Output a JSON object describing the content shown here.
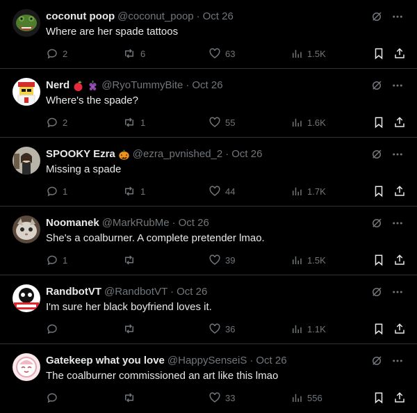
{
  "colors": {
    "background": "#000000",
    "text": "#e7e9ea",
    "muted": "#71767b",
    "divider": "#2f3336"
  },
  "icons": {
    "reply": "reply-icon",
    "retweet": "retweet-icon",
    "like": "heart-icon",
    "views": "views-icon",
    "bookmark": "bookmark-icon",
    "share": "share-icon",
    "grok": "grok-icon",
    "more": "more-icon"
  },
  "tweets": [
    {
      "display_name": "coconut poop",
      "emojis": [],
      "handle": "@coconut_poop",
      "separator": "·",
      "time": "Oct 26",
      "text": "Where are her spade tattoos",
      "replies": "2",
      "retweets": "6",
      "likes": "63",
      "views": "1.5K"
    },
    {
      "display_name": "Nerd",
      "emojis": [
        "apple",
        "grapes"
      ],
      "handle": "@RyoTummyBite",
      "separator": "·",
      "time": "Oct 26",
      "text": "Where's the spade?",
      "replies": "2",
      "retweets": "1",
      "likes": "55",
      "views": "1.6K"
    },
    {
      "display_name": "SPOOKY Ezra",
      "emojis": [
        "jack-o-lantern"
      ],
      "handle": "@ezra_pvnished_2",
      "separator": "·",
      "time": "Oct 26",
      "text": "Missing a spade",
      "replies": "1",
      "retweets": "1",
      "likes": "44",
      "views": "1.7K"
    },
    {
      "display_name": "Noomanek",
      "emojis": [],
      "handle": "@MarkRubMe",
      "separator": "·",
      "time": "Oct 26",
      "text": "She's a coalburner. A complete pretender lmao.",
      "replies": "1",
      "retweets": "",
      "likes": "39",
      "views": "1.5K"
    },
    {
      "display_name": "RandbotVT",
      "emojis": [],
      "handle": "@RandbotVT",
      "separator": "·",
      "time": "Oct 26",
      "text": "I'm sure her black boyfriend loves it.",
      "replies": "",
      "retweets": "",
      "likes": "36",
      "views": "1.1K"
    },
    {
      "display_name": "Gatekeep what you love",
      "emojis": [],
      "handle": "@HappySenseiS",
      "separator": "·",
      "time": "Oct 26",
      "text": "The coalburner commissioned an art like this lmao",
      "replies": "",
      "retweets": "",
      "likes": "33",
      "views": "556"
    }
  ]
}
